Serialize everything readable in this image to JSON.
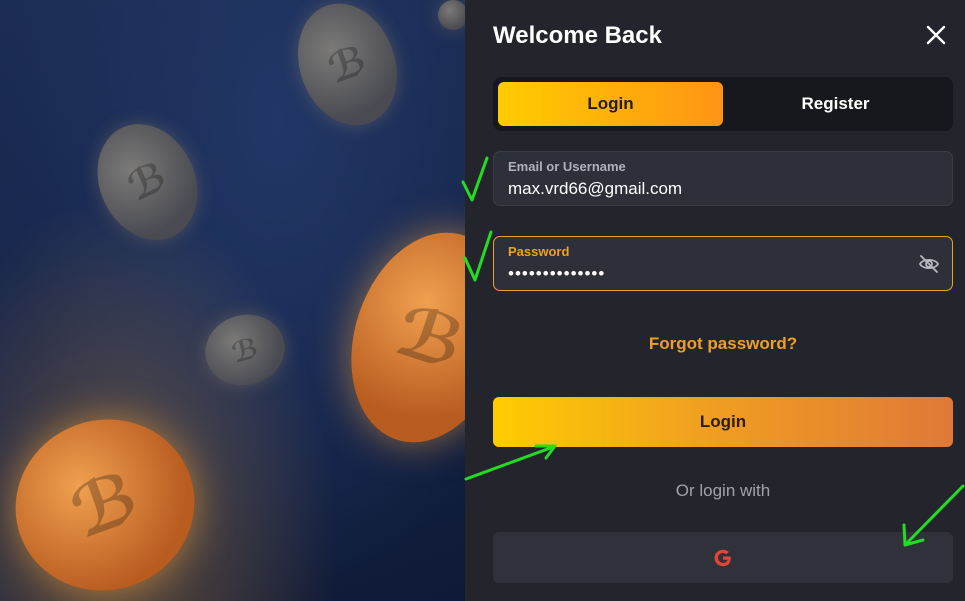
{
  "modal": {
    "title": "Welcome Back"
  },
  "tabs": [
    {
      "label": "Login",
      "active": true
    },
    {
      "label": "Register",
      "active": false
    }
  ],
  "email": {
    "label": "Email or Username",
    "value": "max.vrd66@gmail.com"
  },
  "password": {
    "label": "Password",
    "value": "••••••••••••••"
  },
  "forgot_label": "Forgot password?",
  "login_button_label": "Login",
  "alt_login_text": "Or login with",
  "social": {
    "google_icon": "google-icon"
  },
  "colors": {
    "accent": "#f0a020",
    "panel_bg": "#24252c",
    "annotation": "#22dd22"
  }
}
